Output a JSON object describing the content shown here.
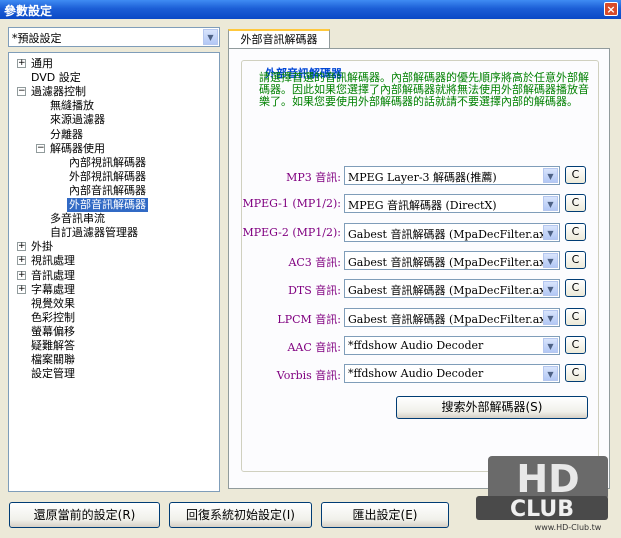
{
  "window": {
    "title": "參數設定",
    "close_glyph": "×"
  },
  "preset": {
    "value": "*預設設定"
  },
  "tree": {
    "items": [
      {
        "label": "通用",
        "exp": "+"
      },
      {
        "label": "DVD 設定",
        "exp": ""
      },
      {
        "label": "過濾器控制",
        "exp": "−"
      },
      {
        "label": "無縫播放",
        "exp": ""
      },
      {
        "label": "來源過濾器",
        "exp": ""
      },
      {
        "label": "分離器",
        "exp": ""
      },
      {
        "label": "解碼器使用",
        "exp": "−"
      },
      {
        "label": "內部視訊解碼器",
        "exp": ""
      },
      {
        "label": "外部視訊解碼器",
        "exp": ""
      },
      {
        "label": "內部音訊解碼器",
        "exp": ""
      },
      {
        "label": "外部音訊解碼器",
        "exp": ""
      },
      {
        "label": "多音訊串流",
        "exp": ""
      },
      {
        "label": "自訂過濾器管理器",
        "exp": ""
      },
      {
        "label": "外掛",
        "exp": "+"
      },
      {
        "label": "視訊處理",
        "exp": "+"
      },
      {
        "label": "音訊處理",
        "exp": "+"
      },
      {
        "label": "字幕處理",
        "exp": "+"
      },
      {
        "label": "視覺效果",
        "exp": ""
      },
      {
        "label": "色彩控制",
        "exp": ""
      },
      {
        "label": "螢幕偏移",
        "exp": ""
      },
      {
        "label": "疑難解答",
        "exp": ""
      },
      {
        "label": "檔案關聯",
        "exp": ""
      },
      {
        "label": "設定管理",
        "exp": ""
      }
    ]
  },
  "tab": {
    "label": "外部音訊解碼器"
  },
  "group": {
    "title": "外部音訊解碼器",
    "description": "請選擇首選的音訊解碼器。內部解碼器的優先順序將高於任意外部解碼器。因此如果您選擇了內部解碼器就將無法使用外部解碼器播放音樂了。如果您要使用外部解碼器的話就請不要選擇內部的解碼器。"
  },
  "decoders": [
    {
      "label": "MP3 音訊:",
      "value": "MPEG Layer-3 解碼器(推薦)",
      "btn": "C"
    },
    {
      "label": "MPEG-1 (MP1/2):",
      "value": "MPEG 音訊解碼器 (DirectX)",
      "btn": "C"
    },
    {
      "label": "MPEG-2 (MP1/2):",
      "value": "Gabest 音訊解碼器 (MpaDecFilter.ax)",
      "btn": "C"
    },
    {
      "label": "AC3 音訊:",
      "value": "Gabest 音訊解碼器 (MpaDecFilter.ax)",
      "btn": "C"
    },
    {
      "label": "DTS 音訊:",
      "value": "Gabest 音訊解碼器 (MpaDecFilter.ax)",
      "btn": "C"
    },
    {
      "label": "LPCM 音訊:",
      "value": "Gabest 音訊解碼器 (MpaDecFilter.ax)",
      "btn": "C"
    },
    {
      "label": "AAC 音訊:",
      "value": "*ffdshow Audio Decoder",
      "btn": "C"
    },
    {
      "label": "Vorbis 音訊:",
      "value": "*ffdshow Audio Decoder",
      "btn": "C"
    }
  ],
  "search_button": "搜索外部解碼器(S)",
  "bottom": {
    "restore": "還原當前的設定(R)",
    "reset": "回復系統初始設定(I)",
    "export": "匯出設定(E)"
  },
  "watermark": {
    "line1": "HD",
    "line2": "CLUB",
    "url": "www.HD-Club.tw"
  },
  "colors": {
    "title_bar": "#1c5ed6",
    "selection": "#316ac5",
    "group_title": "#0046d5",
    "description": "#008000",
    "decoder_label": "#800080"
  }
}
